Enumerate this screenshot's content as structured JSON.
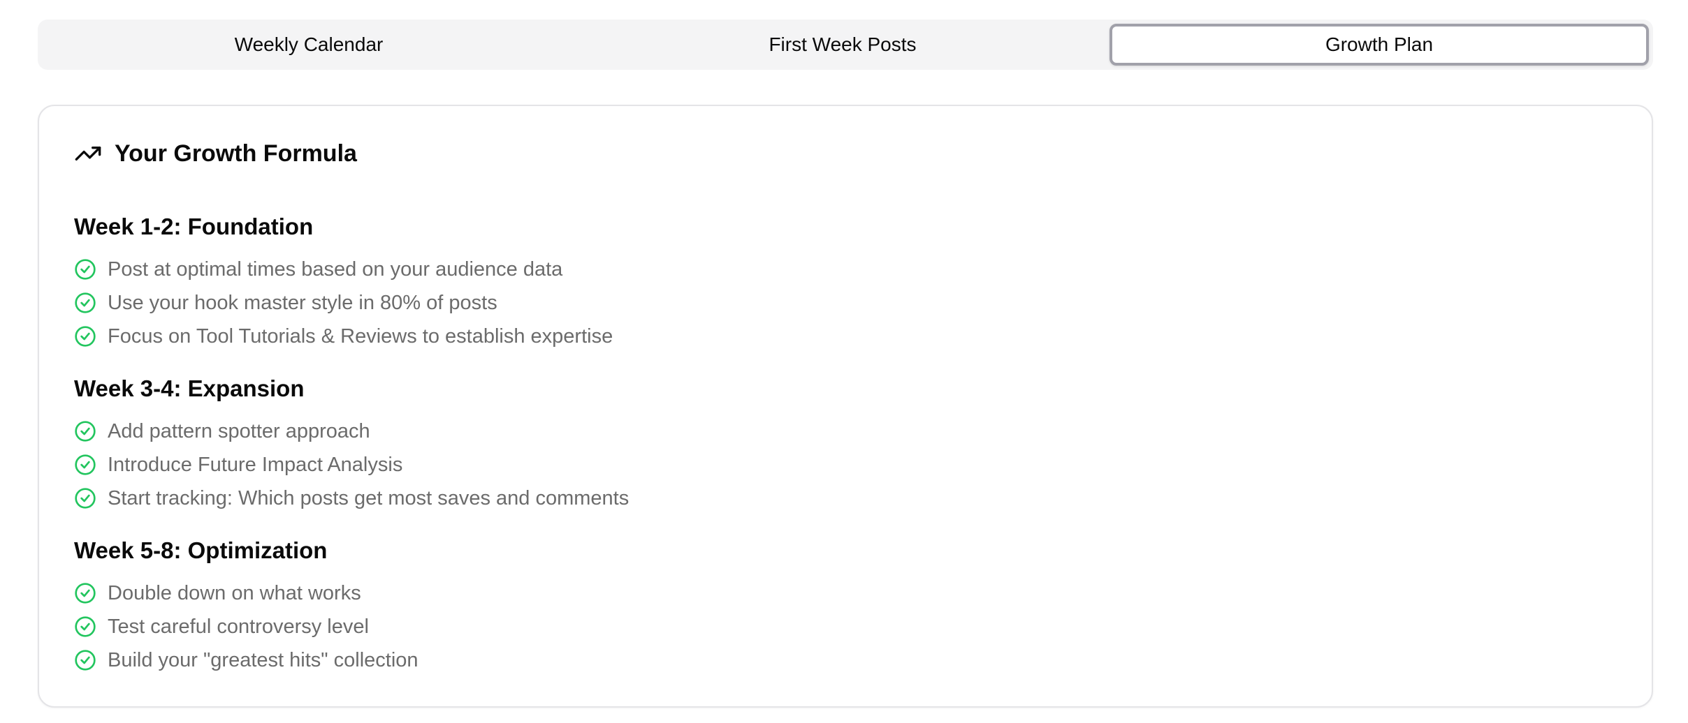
{
  "tabs": [
    {
      "label": "Weekly Calendar",
      "active": false
    },
    {
      "label": "First Week Posts",
      "active": false
    },
    {
      "label": "Growth Plan",
      "active": true
    }
  ],
  "card": {
    "title": "Your Growth Formula",
    "title_icon": "trending-up-icon",
    "phases": [
      {
        "title": "Week 1-2: Foundation",
        "items": [
          "Post at optimal times based on your audience data",
          "Use your hook master style in 80% of posts",
          "Focus on Tool Tutorials & Reviews to establish expertise"
        ]
      },
      {
        "title": "Week 3-4: Expansion",
        "items": [
          "Add pattern spotter approach",
          "Introduce Future Impact Analysis",
          "Start tracking: Which posts get most saves and comments"
        ]
      },
      {
        "title": "Week 5-8: Optimization",
        "items": [
          "Double down on what works",
          "Test careful controversy level",
          "Build your \"greatest hits\" collection"
        ]
      }
    ]
  },
  "colors": {
    "accent_check": "#22c55e",
    "muted_text": "#6b6b6b",
    "tab_bg": "#f4f4f5"
  }
}
